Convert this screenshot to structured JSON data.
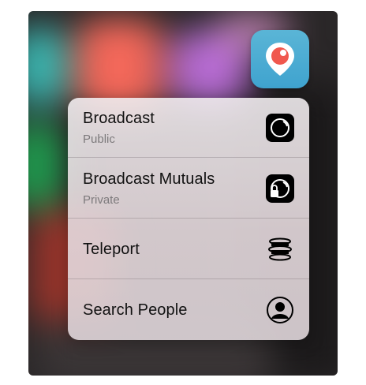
{
  "app": {
    "icon_name": "periscope-icon",
    "brand_color": "#40a4d0"
  },
  "menu": {
    "items": [
      {
        "title": "Broadcast",
        "subtitle": "Public",
        "icon": "broadcast-icon"
      },
      {
        "title": "Broadcast Mutuals",
        "subtitle": "Private",
        "icon": "broadcast-lock-icon"
      },
      {
        "title": "Teleport",
        "icon": "teleport-icon"
      },
      {
        "title": "Search People",
        "icon": "person-icon"
      }
    ]
  }
}
